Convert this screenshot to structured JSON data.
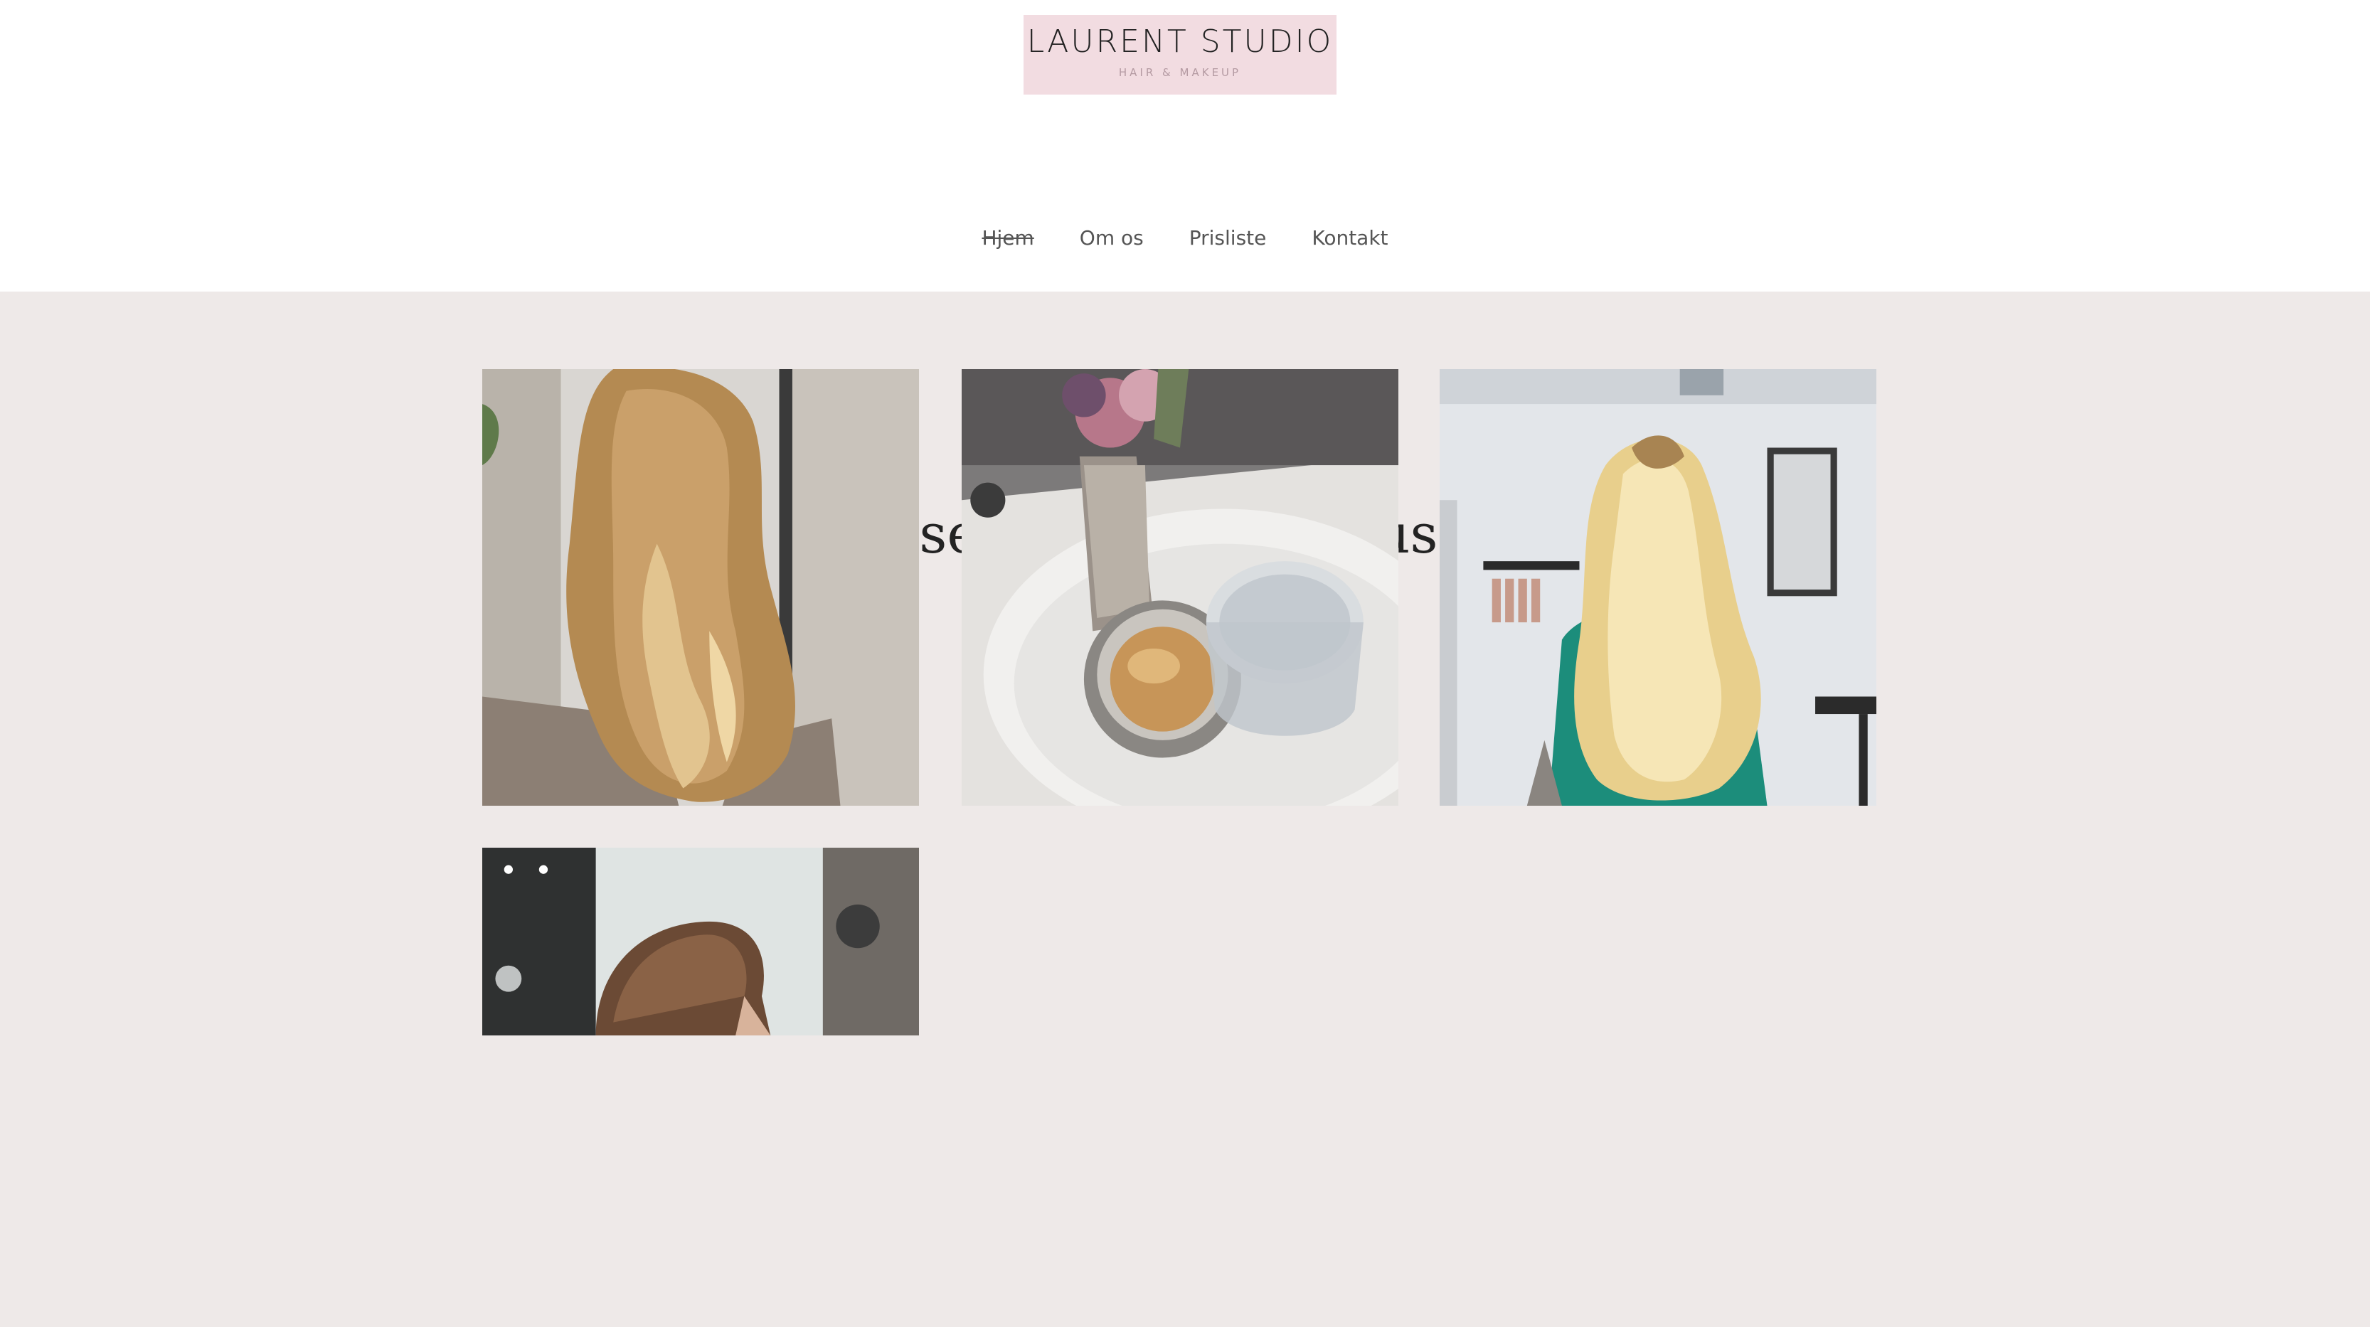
{
  "header": {
    "logo": {
      "title": "LAURENT STUDIO",
      "subtitle": "HAIR & MAKEUP"
    },
    "nav": {
      "items": [
        {
          "label": "Hjem",
          "active": true
        },
        {
          "label": "Om os",
          "active": false
        },
        {
          "label": "Prisliste",
          "active": false
        },
        {
          "label": "Kontakt",
          "active": false
        }
      ]
    }
  },
  "main": {
    "headline": "Forkælelse, luksus og fokus på dig",
    "gallery": [
      {
        "subject": "long wavy blonde balayage hair, back view"
      },
      {
        "subject": "coffee cup, glass of water and dried flower vase on a tray"
      },
      {
        "subject": "long wavy platinum blonde hair, client in green top"
      },
      {
        "subject": "short brown men's haircut, back view"
      }
    ]
  },
  "colors": {
    "page_background": "#eee9e8",
    "header_background": "#ffffff",
    "logo_background": "#f2dce1",
    "accent_divider": "#efc3cd",
    "nav_text": "#555555"
  }
}
